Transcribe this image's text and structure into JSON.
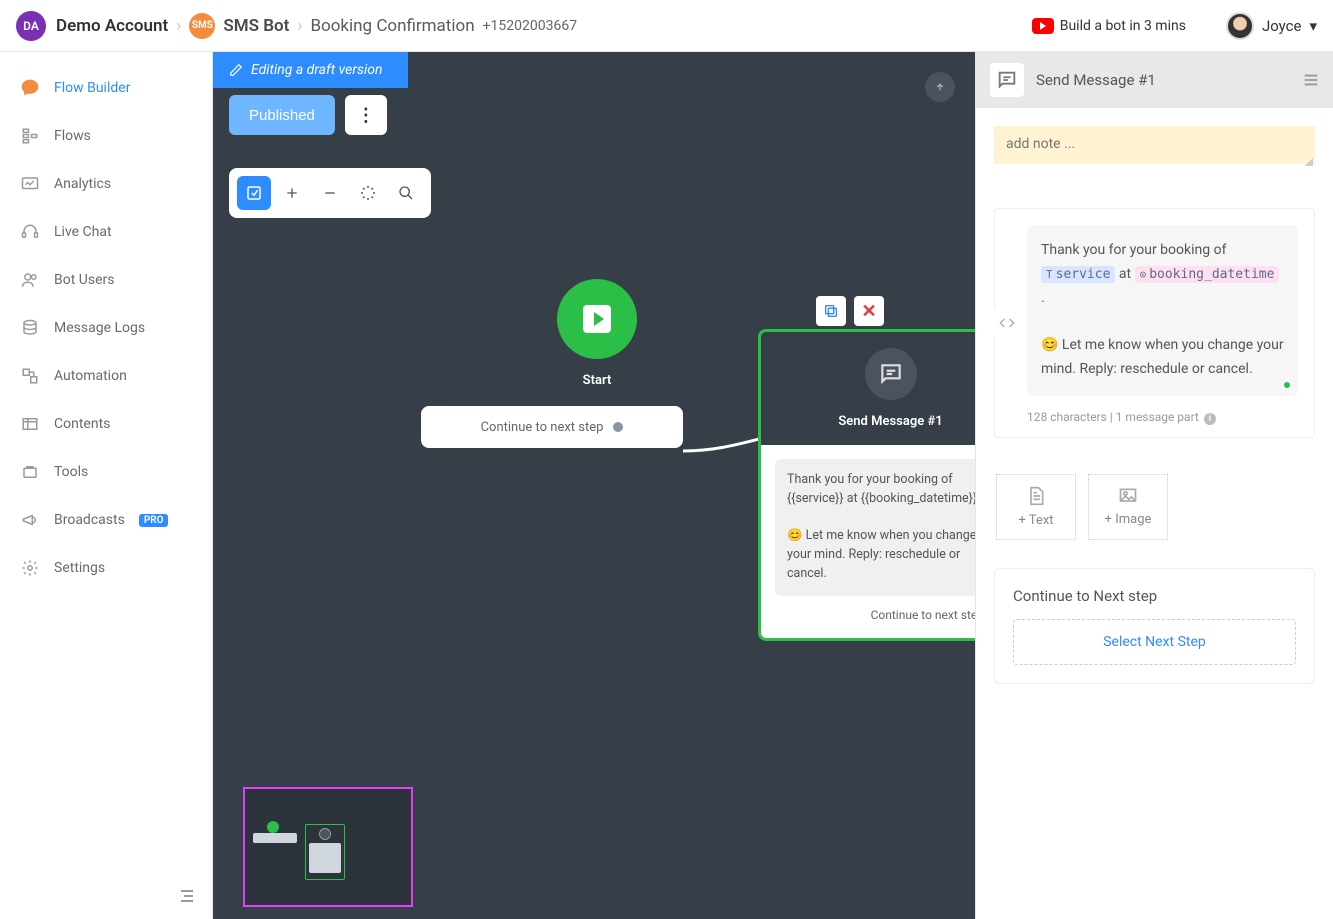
{
  "header": {
    "account_initials": "DA",
    "account": "Demo Account",
    "bot": "SMS Bot",
    "flow": "Booking Confirmation",
    "phone": "+15202003667",
    "video_link": "Build a bot in 3 mins",
    "user_name": "Joyce"
  },
  "sidebar": {
    "items": [
      {
        "label": "Flow Builder"
      },
      {
        "label": "Flows"
      },
      {
        "label": "Analytics"
      },
      {
        "label": "Live Chat"
      },
      {
        "label": "Bot Users"
      },
      {
        "label": "Message Logs"
      },
      {
        "label": "Automation"
      },
      {
        "label": "Contents"
      },
      {
        "label": "Tools"
      },
      {
        "label": "Broadcasts",
        "badge": "PRO"
      },
      {
        "label": "Settings"
      }
    ]
  },
  "canvas": {
    "draft_notice": "Editing a draft version",
    "publish_btn": "Published",
    "start_label": "Start",
    "continue_label": "Continue to next step",
    "send_node": {
      "title": "Send Message #1",
      "message": "Thank you for your booking of {{service}} at {{booking_datetime}}.\n\n😊 Let me know when you change your mind. Reply: reschedule or cancel.",
      "continue": "Continue to next step"
    }
  },
  "panel": {
    "title": "Send Message #1",
    "note_placeholder": "add note ...",
    "message": {
      "prefix": "Thank you for your booking of ",
      "var1_icon": "T",
      "var1": "service",
      "mid": " at ",
      "var2_icon": "⊙",
      "var2": "booking_datetime",
      "suffix": " .",
      "line2": "😊 Let me know when you change your mind. Reply: reschedule or cancel."
    },
    "char_count": "128 characters | 1 message part ",
    "add_text": "+ Text",
    "add_image": "+ Image",
    "next_step_label": "Continue to Next step",
    "select_next": "Select Next Step"
  }
}
